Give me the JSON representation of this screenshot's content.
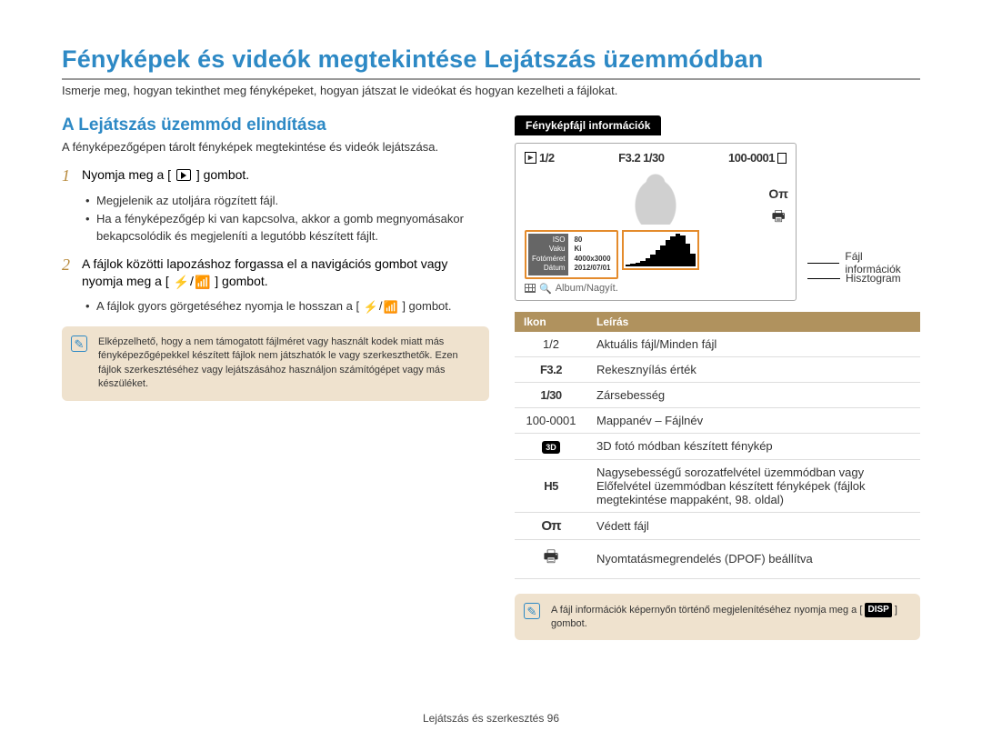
{
  "title": "Fényképek és videók megtekintése Lejátszás üzemmódban",
  "intro": "Ismerje meg, hogyan tekinthet meg fényképeket, hogyan játszat le videókat és hogyan kezelheti a fájlokat.",
  "left": {
    "section_title": "A Lejátszás üzemmód elindítása",
    "section_intro": "A fényképezőgépen tárolt fényképek megtekintése és videók lejátszása.",
    "step1_pre": "Nyomja meg a [",
    "step1_post": "] gombot.",
    "step1_bullets": [
      "Megjelenik az utoljára rögzített fájl.",
      "Ha a fényképezőgép ki van kapcsolva, akkor a gomb megnyomásakor bekapcsolódik és megjeleníti a legutóbb készített fájlt."
    ],
    "step2_a": "A fájlok közötti lapozáshoz forgassa el a navigációs gombot vagy nyomja meg a [",
    "step2_mid": "/",
    "step2_b": "] gombot.",
    "step2_bullet_a": "A fájlok gyors görgetéséhez nyomja le hosszan a [",
    "step2_bullet_b": "] gombot.",
    "note": "Elképzelhető, hogy a nem támogatott fájlméret vagy használt kodek miatt más fényképezőgépekkel készített fájlok nem játszhatók le vagy szerkeszthetők. Ezen fájlok szerkesztéséhez vagy lejátszásához használjon számítógépet vagy más készüléket."
  },
  "right": {
    "pill": "Fényképfájl információk",
    "screen": {
      "counter": "1/2",
      "aperture": "F3.2",
      "shutter": "1/30",
      "folderfile": "100-0001",
      "info": {
        "iso_l": "ISO",
        "iso_v": "80",
        "flash_l": "Vaku",
        "flash_v": "Ki",
        "size_l": "Fotóméret",
        "size_v": "4000x3000",
        "date_l": "Dátum",
        "date_v": "2012/07/01"
      },
      "bottom": "Album/Nagyít."
    },
    "callout1": "Fájl információk",
    "callout2": "Hisztogram",
    "table_header_icon": "Ikon",
    "table_header_desc": "Leírás",
    "rows": [
      {
        "icon": "1/2",
        "desc": "Aktuális fájl/Minden fájl",
        "style": "plain"
      },
      {
        "icon": "F3.2",
        "desc": "Rekesznyílás érték",
        "style": "bold"
      },
      {
        "icon": "1/30",
        "desc": "Zársebesség",
        "style": "bold"
      },
      {
        "icon": "100-0001",
        "desc": "Mappanév – Fájlnév",
        "style": "plain"
      },
      {
        "icon": "3D",
        "desc": "3D fotó módban készített fénykép",
        "style": "3d"
      },
      {
        "icon": "H5",
        "desc": "Nagysebességű sorozatfelvétel üzemmódban vagy Előfelvétel üzemmódban készített fényképek (fájlok megtekintése mappaként, 98. oldal)",
        "style": "bold"
      },
      {
        "icon": "Oπ",
        "desc": "Védett fájl",
        "style": "key"
      },
      {
        "icon": "🖶",
        "desc": "Nyomtatásmegrendelés (DPOF) beállítva",
        "style": "printer"
      }
    ],
    "note_pre": "A fájl információk képernyőn történő megjelenítéséhez nyomja meg a [",
    "note_disp": "DISP",
    "note_post": "] gombot."
  },
  "footer": "Lejátszás és szerkesztés  96"
}
